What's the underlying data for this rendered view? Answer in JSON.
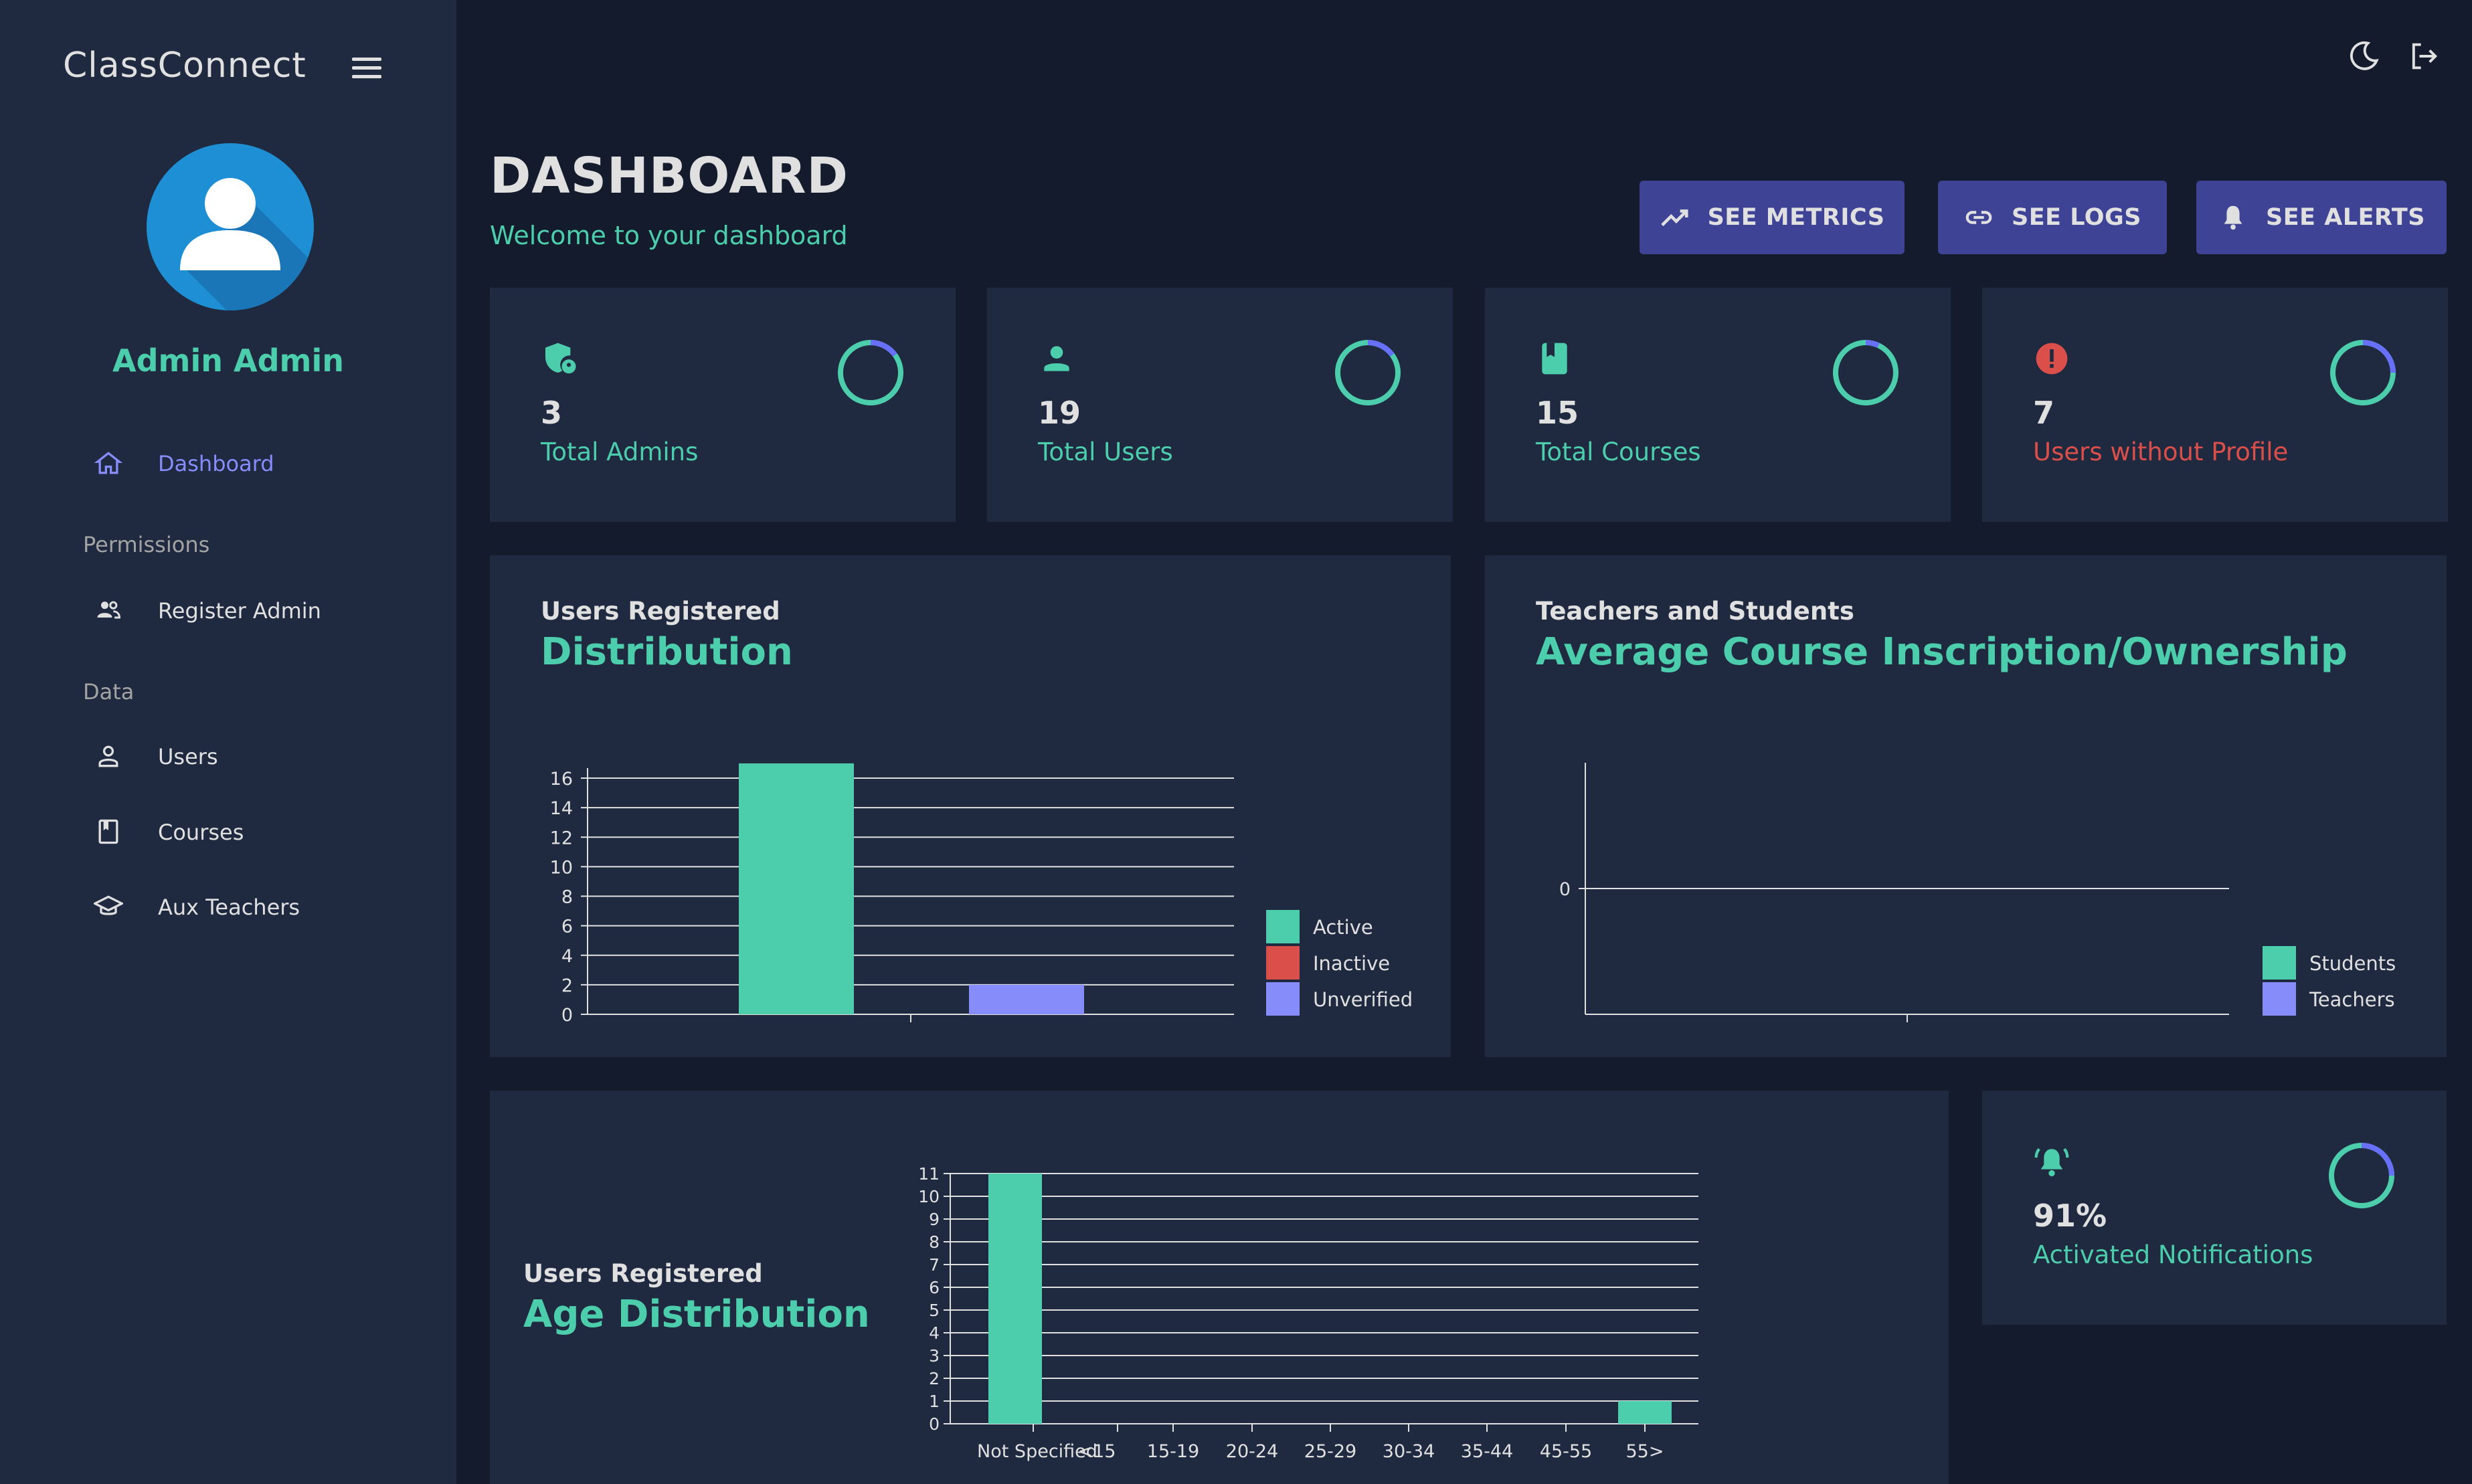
{
  "app": {
    "brand": "ClassConnect"
  },
  "user": {
    "name": "Admin Admin"
  },
  "sidebar": {
    "items": [
      {
        "label": "Dashboard",
        "icon": "home-icon",
        "active": true
      },
      {
        "label": "Register Admin",
        "icon": "people-icon"
      },
      {
        "label": "Users",
        "icon": "person-icon"
      },
      {
        "label": "Courses",
        "icon": "book-icon"
      },
      {
        "label": "Aux Teachers",
        "icon": "school-icon"
      }
    ],
    "sections": {
      "permissions": "Permissions",
      "data": "Data"
    }
  },
  "header": {
    "title": "DASHBOARD",
    "subtitle": "Welcome to your dashboard",
    "buttons": {
      "metrics": "SEE METRICS",
      "logs": "SEE LOGS",
      "alerts": "SEE ALERTS"
    }
  },
  "stats": [
    {
      "value": "3",
      "label": "Total Admins",
      "icon": "admin-shield-icon",
      "label_color": "#4cceac",
      "progress": 0.85
    },
    {
      "value": "19",
      "label": "Total Users",
      "icon": "person-icon",
      "label_color": "#4cceac",
      "progress": 0.85
    },
    {
      "value": "15",
      "label": "Total Courses",
      "icon": "book-icon",
      "label_color": "#4cceac",
      "progress": 0.93
    },
    {
      "value": "7",
      "label": "Users without Profile",
      "icon": "error-icon",
      "label_color": "#db4f4a",
      "progress": 0.75
    }
  ],
  "notifications_card": {
    "value": "91%",
    "label": "Activated Notifications",
    "progress": 0.75
  },
  "colors": {
    "accent": "#4cceac",
    "brand": "#3e4396",
    "red": "#db4f4a",
    "blue": "#868dfb",
    "panel": "#1f2a40",
    "bg": "#141b2d"
  },
  "chart_data": [
    {
      "type": "bar",
      "subtitle": "Users Registered",
      "title": "Distribution",
      "categories": [
        "Active",
        "Inactive",
        "Unverified"
      ],
      "values": [
        17,
        0,
        2
      ],
      "yticks": [
        0,
        2,
        4,
        6,
        8,
        10,
        12,
        14,
        16
      ],
      "ylim": [
        0,
        16
      ],
      "legend": [
        "Active",
        "Inactive",
        "Unverified"
      ],
      "legend_colors": [
        "#4cceac",
        "#db4f4a",
        "#868dfb"
      ],
      "legend_position": "bottom-right",
      "grid": true
    },
    {
      "type": "bar",
      "subtitle": "Teachers and Students",
      "title": "Average Course Inscription/Ownership",
      "series": [
        {
          "name": "Students",
          "values": []
        },
        {
          "name": "Teachers",
          "values": []
        }
      ],
      "yticks": [
        0
      ],
      "legend_colors": [
        "#4cceac",
        "#868dfb"
      ],
      "legend_position": "bottom-right"
    },
    {
      "type": "bar",
      "subtitle": "Users Registered",
      "title": "Age Distribution",
      "categories": [
        "Not Specified",
        "<15",
        "15-19",
        "20-24",
        "25-29",
        "30-34",
        "35-44",
        "45-55",
        "55>"
      ],
      "values": [
        11,
        0,
        0,
        0,
        0,
        0,
        0,
        0,
        1
      ],
      "yticks": [
        0,
        1,
        2,
        3,
        4,
        5,
        6,
        7,
        8,
        9,
        10,
        11
      ],
      "ylim": [
        0,
        11
      ],
      "grid": true
    }
  ]
}
